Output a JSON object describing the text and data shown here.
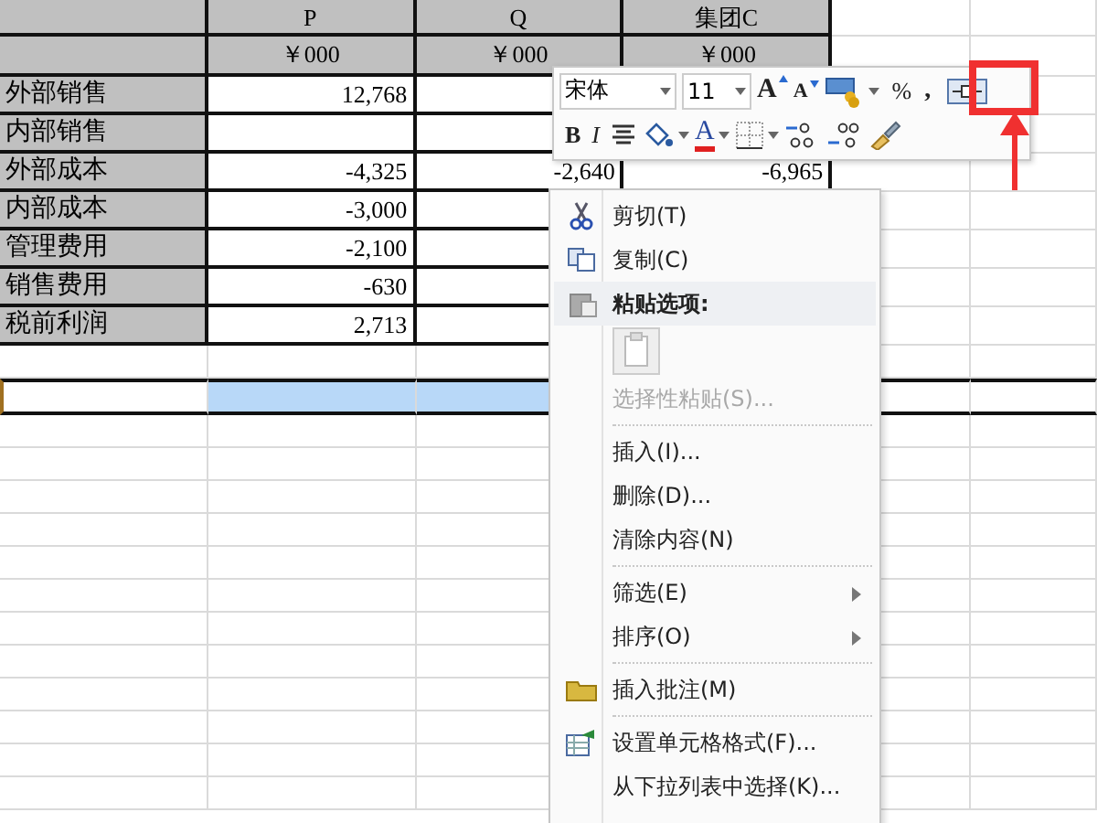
{
  "sheet": {
    "columns": [
      {
        "header": "P",
        "unit": "￥000"
      },
      {
        "header": "Q",
        "unit": "￥000"
      },
      {
        "header": "集团C",
        "unit": "￥000"
      }
    ],
    "rows": [
      {
        "label": "外部销售",
        "p": "12,768"
      },
      {
        "label": "内部销售"
      },
      {
        "label": "外部成本",
        "p": "-4,325",
        "q": "-2,640",
        "c": "-6,965"
      },
      {
        "label": "内部成本",
        "p": "-3,000"
      },
      {
        "label": "管理费用",
        "p": "-2,100"
      },
      {
        "label": "销售费用",
        "p": "-630"
      },
      {
        "label": "税前利润",
        "p": "2,713"
      }
    ],
    "blank_rows": [
      {
        "selected": false
      },
      {
        "selected": true
      },
      {
        "selected": false
      },
      {
        "selected": false
      },
      {
        "selected": false
      },
      {
        "selected": false
      },
      {
        "selected": false
      },
      {
        "selected": false
      },
      {
        "selected": false
      },
      {
        "selected": false
      },
      {
        "selected": false
      },
      {
        "selected": false
      },
      {
        "selected": false
      },
      {
        "selected": false
      }
    ]
  },
  "mini_toolbar": {
    "font": "宋体",
    "size": "11",
    "grow": "A",
    "shrink": "A",
    "percent": "%",
    "comma": ",",
    "bold": "B",
    "italic": "I",
    "font_color": "A"
  },
  "context_menu": [
    {
      "kind": "item",
      "label": "剪切(T)",
      "disabled": false,
      "submenu": false
    },
    {
      "kind": "item",
      "label": "复制(C)",
      "disabled": false,
      "submenu": false
    },
    {
      "kind": "header",
      "label": "粘贴选项:"
    },
    {
      "kind": "paste-option"
    },
    {
      "kind": "item",
      "label": "选择性粘贴(S)...",
      "disabled": true,
      "submenu": false
    },
    {
      "kind": "separator"
    },
    {
      "kind": "item",
      "label": "插入(I)...",
      "disabled": false,
      "submenu": false
    },
    {
      "kind": "item",
      "label": "删除(D)...",
      "disabled": false,
      "submenu": false
    },
    {
      "kind": "item",
      "label": "清除内容(N)",
      "disabled": false,
      "submenu": false
    },
    {
      "kind": "separator"
    },
    {
      "kind": "item",
      "label": "筛选(E)",
      "disabled": false,
      "submenu": true
    },
    {
      "kind": "item",
      "label": "排序(O)",
      "disabled": false,
      "submenu": true
    },
    {
      "kind": "separator"
    },
    {
      "kind": "item",
      "label": "插入批注(M)",
      "disabled": false,
      "submenu": false
    },
    {
      "kind": "separator"
    },
    {
      "kind": "item",
      "label": "设置单元格格式(F)...",
      "disabled": false,
      "submenu": false
    },
    {
      "kind": "item",
      "label": "从下拉列表中选择(K)...",
      "disabled": false,
      "submenu": false
    }
  ]
}
